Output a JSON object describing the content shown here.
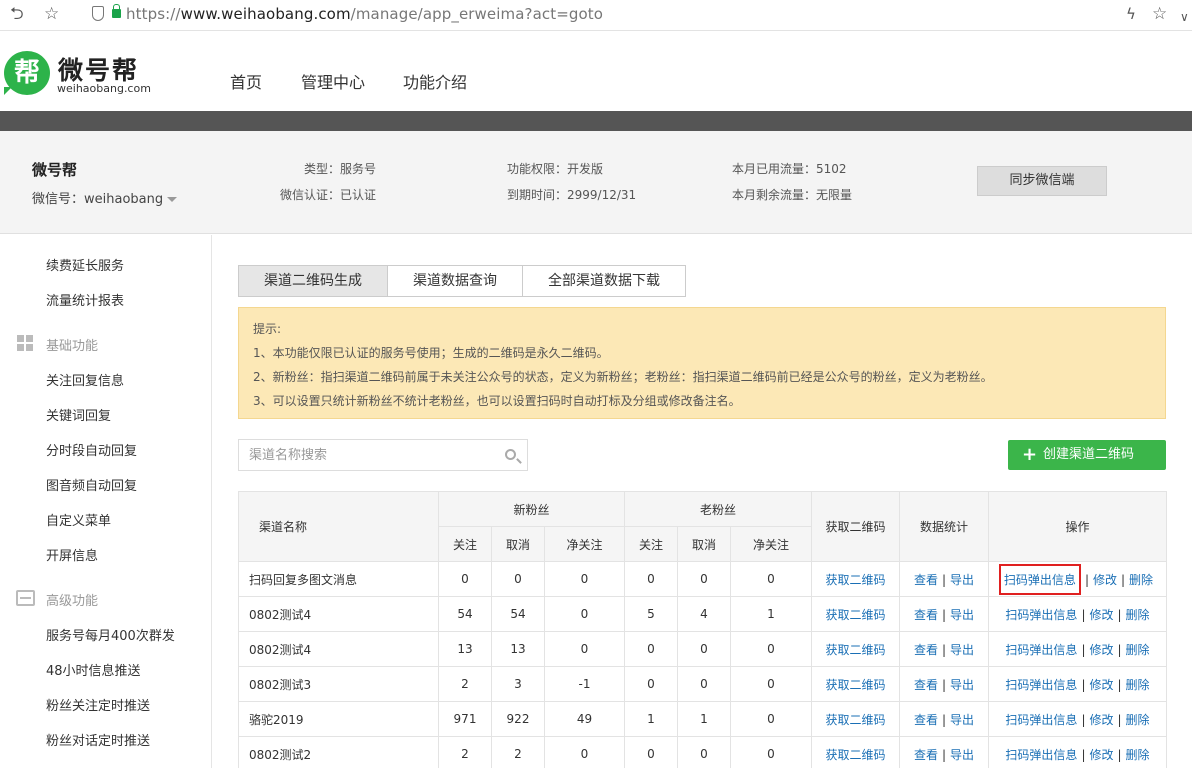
{
  "browser": {
    "url_prefix": "https://",
    "url_domain": "www.weihaobang.com",
    "url_path": "/manage/app_erweima?act=goto"
  },
  "header": {
    "logo_char": "帮",
    "logo_name": "微号帮",
    "logo_domain": "weihaobang.com",
    "nav": [
      "首页",
      "管理中心",
      "功能介绍"
    ]
  },
  "account": {
    "name": "微号帮",
    "wx_label": "微信号：weihaobang",
    "type_label": "类型：",
    "type_value": "服务号",
    "verify_label": "微信认证：",
    "verify_value": "已认证",
    "perm_label": "功能权限：",
    "perm_value": "开发版",
    "expire_label": "到期时间：",
    "expire_value": "2999/12/31",
    "used_label": "本月已用流量：",
    "used_value": "5102",
    "remain_label": "本月剩余流量：",
    "remain_value": "无限量",
    "sync_button": "同步微信端"
  },
  "sidebar": {
    "top_items": [
      "续费延长服务",
      "流量统计报表"
    ],
    "group1": "基础功能",
    "group1_items": [
      "关注回复信息",
      "关键词回复",
      "分时段自动回复",
      "图音频自动回复",
      "自定义菜单",
      "开屏信息"
    ],
    "group2": "高级功能",
    "group2_items": [
      "服务号每月400次群发",
      "48小时信息推送",
      "粉丝关注定时推送",
      "粉丝对话定时推送"
    ]
  },
  "tabs": [
    "渠道二维码生成",
    "渠道数据查询",
    "全部渠道数据下载"
  ],
  "tip": {
    "title": "提示:",
    "lines": [
      "1、本功能仅限已认证的服务号使用；生成的二维码是永久二维码。",
      "2、新粉丝：指扫渠道二维码前属于未关注公众号的状态，定义为新粉丝；老粉丝：指扫渠道二维码前已经是公众号的粉丝，定义为老粉丝。",
      "3、可以设置只统计新粉丝不统计老粉丝，也可以设置扫码时自动打标及分组或修改备注名。"
    ]
  },
  "search": {
    "placeholder": "渠道名称搜索"
  },
  "create_button": "创建渠道二维码",
  "table": {
    "headers": {
      "name": "渠道名称",
      "new_fans": "新粉丝",
      "old_fans": "老粉丝",
      "get_qr": "获取二维码",
      "stats": "数据统计",
      "ops": "操作",
      "follow": "关注",
      "cancel": "取消",
      "net": "净关注"
    },
    "link_labels": {
      "get_qr": "获取二维码",
      "view": "查看",
      "export": "导出",
      "scan_popup": "扫码弹出信息",
      "edit": "修改",
      "delete": "删除",
      "sep": "|"
    },
    "rows": [
      {
        "name": "扫码回复多图文消息",
        "n1": "0",
        "n2": "0",
        "n3": "0",
        "o1": "0",
        "o2": "0",
        "o3": "0"
      },
      {
        "name": "0802测试4",
        "n1": "54",
        "n2": "54",
        "n3": "0",
        "o1": "5",
        "o2": "4",
        "o3": "1"
      },
      {
        "name": "0802测试4",
        "n1": "13",
        "n2": "13",
        "n3": "0",
        "o1": "0",
        "o2": "0",
        "o3": "0"
      },
      {
        "name": "0802测试3",
        "n1": "2",
        "n2": "3",
        "n3": "-1",
        "o1": "0",
        "o2": "0",
        "o3": "0"
      },
      {
        "name": "骆驼2019",
        "n1": "971",
        "n2": "922",
        "n3": "49",
        "o1": "1",
        "o2": "1",
        "o3": "0"
      },
      {
        "name": "0802测试2",
        "n1": "2",
        "n2": "2",
        "n3": "0",
        "o1": "0",
        "o2": "0",
        "o3": "0"
      }
    ]
  },
  "colors": {
    "accent_green": "#3bb54a",
    "link_blue": "#1a6fb5",
    "highlight_red": "#e02020",
    "tip_bg": "#fce8b6"
  }
}
